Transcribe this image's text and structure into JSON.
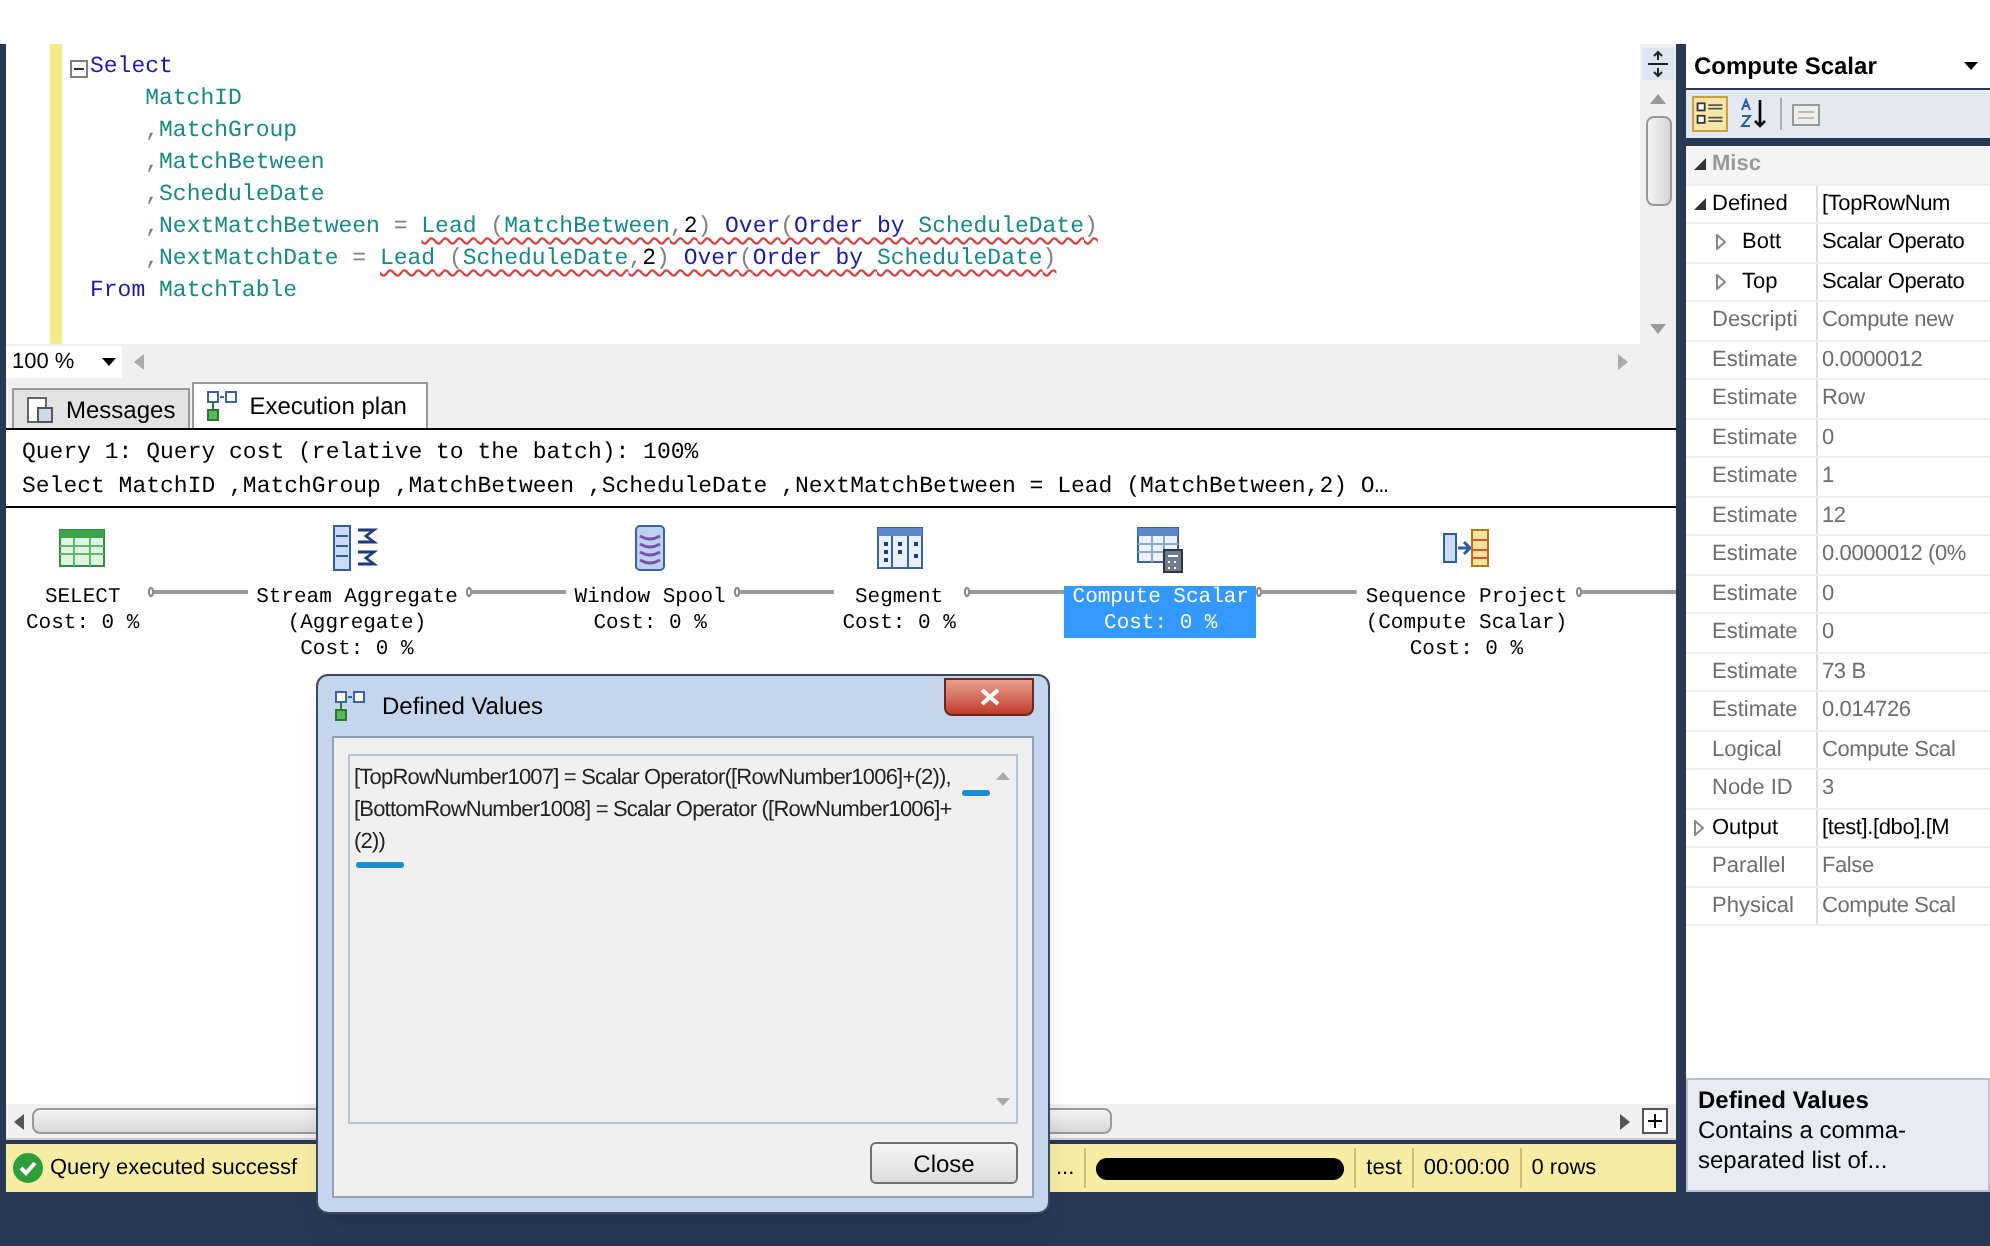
{
  "editor": {
    "lines": [
      {
        "tokens": [
          {
            "text": "Select",
            "kind": "keyword",
            "error": false
          }
        ]
      },
      {
        "tokens": [
          {
            "text": "    MatchID",
            "kind": "identifier",
            "error": false
          }
        ]
      },
      {
        "tokens": [
          {
            "text": "    ,",
            "kind": "operator",
            "error": false
          },
          {
            "text": "MatchGroup",
            "kind": "identifier",
            "error": false
          }
        ]
      },
      {
        "tokens": [
          {
            "text": "    ,",
            "kind": "operator",
            "error": false
          },
          {
            "text": "MatchBetween",
            "kind": "identifier",
            "error": false
          }
        ]
      },
      {
        "tokens": [
          {
            "text": "    ,",
            "kind": "operator",
            "error": false
          },
          {
            "text": "ScheduleDate",
            "kind": "identifier",
            "error": false
          }
        ]
      },
      {
        "tokens": [
          {
            "text": "    ,",
            "kind": "operator",
            "error": false
          },
          {
            "text": "NextMatchBetween",
            "kind": "identifier",
            "error": false
          },
          {
            "text": " = ",
            "kind": "operator",
            "error": false
          },
          {
            "text": "Lead",
            "kind": "identifier",
            "error": true
          },
          {
            "text": " (",
            "kind": "operator",
            "error": true
          },
          {
            "text": "MatchBetween",
            "kind": "identifier",
            "error": true
          },
          {
            "text": ",",
            "kind": "operator",
            "error": true
          },
          {
            "text": "2",
            "kind": "number",
            "error": true
          },
          {
            "text": ") ",
            "kind": "operator",
            "error": true
          },
          {
            "text": "Over",
            "kind": "keyword",
            "error": true
          },
          {
            "text": "(",
            "kind": "operator",
            "error": true
          },
          {
            "text": "Order by ",
            "kind": "keyword",
            "error": true
          },
          {
            "text": "ScheduleDate",
            "kind": "identifier",
            "error": true
          },
          {
            "text": ")",
            "kind": "operator",
            "error": true
          }
        ]
      },
      {
        "tokens": [
          {
            "text": "    ,",
            "kind": "operator",
            "error": false
          },
          {
            "text": "NextMatchDate",
            "kind": "identifier",
            "error": false
          },
          {
            "text": " = ",
            "kind": "operator",
            "error": false
          },
          {
            "text": "Lead",
            "kind": "identifier",
            "error": true
          },
          {
            "text": " (",
            "kind": "operator",
            "error": true
          },
          {
            "text": "ScheduleDate",
            "kind": "identifier",
            "error": true
          },
          {
            "text": ",",
            "kind": "operator",
            "error": true
          },
          {
            "text": "2",
            "kind": "number",
            "error": true
          },
          {
            "text": ") ",
            "kind": "operator",
            "error": true
          },
          {
            "text": "Over",
            "kind": "keyword",
            "error": true
          },
          {
            "text": "(",
            "kind": "operator",
            "error": true
          },
          {
            "text": "Order by ",
            "kind": "keyword",
            "error": true
          },
          {
            "text": "ScheduleDate",
            "kind": "identifier",
            "error": true
          },
          {
            "text": ")",
            "kind": "operator",
            "error": true
          }
        ]
      },
      {
        "tokens": [
          {
            "text": "From ",
            "kind": "keyword",
            "error": false
          },
          {
            "text": "MatchTable",
            "kind": "identifier",
            "error": false
          }
        ]
      }
    ],
    "zoom": "100 %"
  },
  "result_tabs": [
    {
      "label": "Messages",
      "kind": "messages",
      "selected": false
    },
    {
      "label": "Execution plan",
      "kind": "plan",
      "selected": true
    }
  ],
  "plan": {
    "header": "Query 1: Query cost (relative to the batch): 100%",
    "statement": "Select MatchID ,MatchGroup ,MatchBetween ,ScheduleDate ,NextMatchBetween = Lead (MatchBetween,2) O…",
    "operators": [
      {
        "kind": "select",
        "name": "SELECT",
        "cost": "Cost: 0 %",
        "selected": false
      },
      {
        "kind": "stream_aggregate",
        "name": "Stream Aggregate",
        "subtitle": "(Aggregate)",
        "cost": "Cost: 0 %",
        "selected": false
      },
      {
        "kind": "window_spool",
        "name": "Window Spool",
        "cost": "Cost: 0 %",
        "selected": false
      },
      {
        "kind": "segment",
        "name": "Segment",
        "cost": "Cost: 0 %",
        "selected": false
      },
      {
        "kind": "compute_scalar",
        "name": "Compute Scalar",
        "cost": "Cost: 0 %",
        "selected": true
      },
      {
        "kind": "sequence_project",
        "name": "Sequence Project",
        "subtitle": "(Compute Scalar)",
        "cost": "Cost: 0 %",
        "selected": false
      }
    ]
  },
  "status_bar": {
    "message": "Query executed successf",
    "ellipsis": "...",
    "database": "test",
    "elapsed": "00:00:00",
    "rows": "0 rows"
  },
  "properties": {
    "title": "Compute Scalar",
    "rows": [
      {
        "kind": "category",
        "name": "Misc",
        "expanded": true
      },
      {
        "kind": "property",
        "name": "Defined",
        "value": "[TopRowNum",
        "expanded": true
      },
      {
        "kind": "child",
        "name": "Bott",
        "value": "Scalar Operato",
        "expanded": false
      },
      {
        "kind": "child",
        "name": "Top",
        "value": "Scalar Operato",
        "expanded": false
      },
      {
        "kind": "property",
        "name": "Descripti",
        "value": "Compute new"
      },
      {
        "kind": "property",
        "name": "Estimate",
        "value": "0.0000012"
      },
      {
        "kind": "property",
        "name": "Estimate",
        "value": "Row"
      },
      {
        "kind": "property",
        "name": "Estimate",
        "value": "0"
      },
      {
        "kind": "property",
        "name": "Estimate",
        "value": "1"
      },
      {
        "kind": "property",
        "name": "Estimate",
        "value": "12"
      },
      {
        "kind": "property",
        "name": "Estimate",
        "value": "0.0000012 (0%"
      },
      {
        "kind": "property",
        "name": "Estimate",
        "value": "0"
      },
      {
        "kind": "property",
        "name": "Estimate",
        "value": "0"
      },
      {
        "kind": "property",
        "name": "Estimate",
        "value": "73 B"
      },
      {
        "kind": "property",
        "name": "Estimate",
        "value": "0.014726"
      },
      {
        "kind": "property",
        "name": "Logical",
        "value": "Compute Scal"
      },
      {
        "kind": "property",
        "name": "Node ID",
        "value": "3"
      },
      {
        "kind": "property",
        "name": "Output",
        "value": "[test].[dbo].[M",
        "expanded": false
      },
      {
        "kind": "property",
        "name": "Parallel",
        "value": "False"
      },
      {
        "kind": "property",
        "name": "Physical",
        "value": "Compute Scal"
      }
    ],
    "description": {
      "title": "Defined Values",
      "text": "Contains a comma-separated list of..."
    }
  },
  "dialog": {
    "title": "Defined Values",
    "text": "[TopRowNumber1007] = Scalar Operator([RowNumber1006]+(2)), [BottomRowNumber1008] = Scalar Operator ([RowNumber1006]+(2))",
    "button": "Close"
  }
}
